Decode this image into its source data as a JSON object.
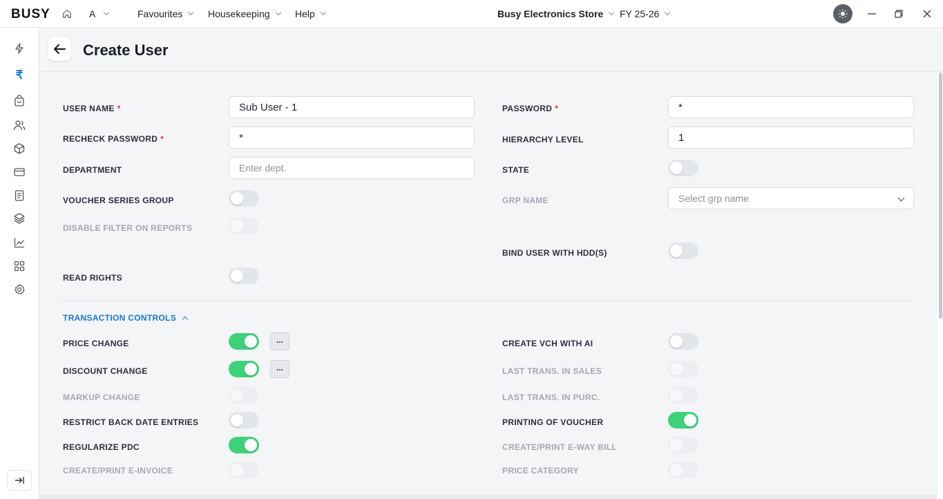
{
  "topbar": {
    "logo": "BUSY",
    "user_initial": "A",
    "menus": [
      "Favourites",
      "Housekeeping",
      "Help"
    ],
    "company": "Busy Electronics Store",
    "fiscal_year": "FY 25-26"
  },
  "page": {
    "title": "Create User"
  },
  "form": {
    "user_name": {
      "label": "USER NAME",
      "value": "Sub User - 1"
    },
    "password": {
      "label": "PASSWORD",
      "value": "*"
    },
    "recheck_password": {
      "label": "RECHECK PASSWORD",
      "value": "*"
    },
    "hierarchy_level": {
      "label": "HIERARCHY LEVEL",
      "value": "1"
    },
    "department": {
      "label": "DEPARTMENT",
      "placeholder": "Enter dept."
    },
    "state": {
      "label": "STATE",
      "on": false
    },
    "voucher_series_group": {
      "label": "VOUCHER SERIES GROUP",
      "on": false
    },
    "grp_name": {
      "label": "GRP NAME",
      "placeholder": "Select grp name"
    },
    "disable_filter": {
      "label": "DISABLE FILTER ON REPORTS",
      "on": false
    },
    "bind_user_hdd": {
      "label": "BIND USER WITH HDD(S)",
      "on": false
    },
    "read_rights": {
      "label": "READ RIGHTS",
      "on": false
    }
  },
  "transaction_controls": {
    "title": "TRANSACTION CONTROLS",
    "price_change": {
      "label": "PRICE CHANGE",
      "on": true,
      "more": "..."
    },
    "discount_change": {
      "label": "DISCOUNT CHANGE",
      "on": true,
      "more": "..."
    },
    "markup_change": {
      "label": "MARKUP CHANGE",
      "on": false
    },
    "restrict_back_date": {
      "label": "RESTRICT BACK DATE ENTRIES",
      "on": false
    },
    "regularize_pdc": {
      "label": "REGULARIZE PDC",
      "on": true
    },
    "e_invoice": {
      "label": "CREATE/PRINT E-INVOICE",
      "on": false
    },
    "create_vch_ai": {
      "label": "CREATE VCH WITH AI",
      "on": false
    },
    "last_trans_sales": {
      "label": "LAST TRANS. IN SALES",
      "on": false
    },
    "last_trans_purc": {
      "label": "LAST TRANS. IN PURC.",
      "on": false
    },
    "printing_voucher": {
      "label": "PRINTING OF VOUCHER",
      "on": true
    },
    "e_way_bill": {
      "label": "CREATE/PRINT E-WAY BILL",
      "on": false
    },
    "price_category": {
      "label": "PRICE CATEGORY",
      "on": false
    }
  },
  "colors": {
    "accent": "#1677d2",
    "toggle_on": "#3dd17a",
    "required": "#e0322f"
  },
  "icons": [
    "home-icon",
    "theme-icon",
    "minimize-icon",
    "restore-icon",
    "close-icon",
    "back-arrow-icon",
    "bolt-icon",
    "rupee-icon",
    "bag-icon",
    "users-icon",
    "box-icon",
    "card-icon",
    "document-icon",
    "layers-icon",
    "chart-icon",
    "grid-icon",
    "settings-icon",
    "expand-sidebar-icon"
  ]
}
